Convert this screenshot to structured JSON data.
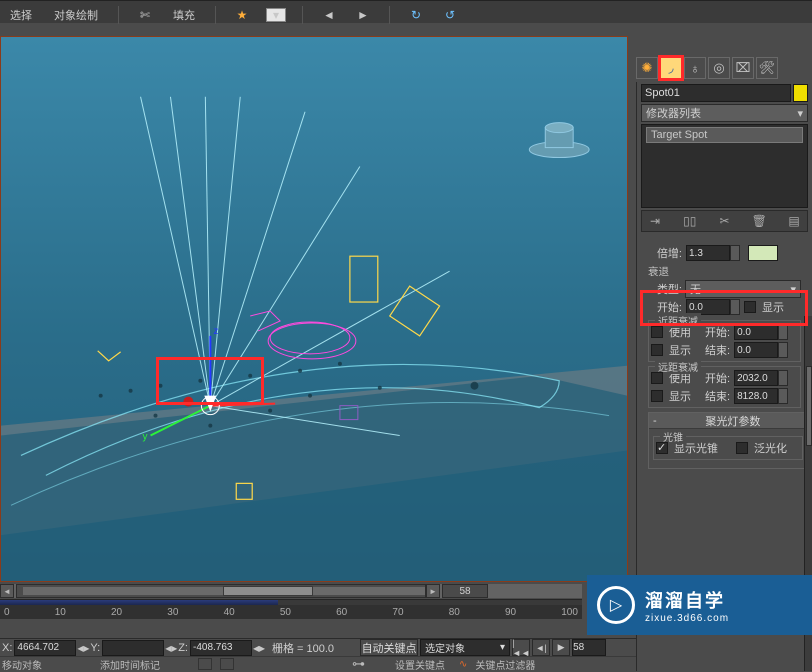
{
  "top_tabs": {
    "select": "选择",
    "object_paint": "对象绘制",
    "fill": "填充"
  },
  "object_name": "Spot01",
  "modifier_list_label": "修改器列表",
  "modstack_item": "Target Spot",
  "intensity": {
    "multiplier_label": "倍增:",
    "multiplier_value": "1.3",
    "decay_label": "衰退",
    "type_label": "类型:",
    "type_value": "无",
    "start_label": "开始:",
    "start_value": "0.0",
    "show_label": "显示"
  },
  "near_atten": {
    "title": "近距衰减",
    "use": "使用",
    "show": "显示",
    "start_label": "开始:",
    "start_value": "0.0",
    "end_label": "结束:",
    "end_value": "0.0"
  },
  "far_atten": {
    "title": "远距衰减",
    "use": "使用",
    "show": "显示",
    "start_label": "开始:",
    "start_value": "2032.0",
    "end_label": "结束:",
    "end_value": "8128.0"
  },
  "spot_params": {
    "title": "聚光灯参数",
    "cone_title": "光锥",
    "show_cone": "显示光锥",
    "overshoot": "泛光化"
  },
  "timeline": {
    "frame_label": "58 / 100",
    "current": "58"
  },
  "ruler": [
    "0",
    "10",
    "20",
    "30",
    "40",
    "50",
    "60",
    "70",
    "80",
    "90",
    "100"
  ],
  "status": {
    "x_label": "X:",
    "x": "4664.702",
    "y_label": "Y:",
    "y": "",
    "z_label": "Z:",
    "z": "-408.763",
    "grid": "栅格 = 100.0",
    "autokey": "自动关键点",
    "keyfilter_sel": "选定对象",
    "frame": "58"
  },
  "status2": {
    "move": "移动对象",
    "addtag": "添加时间标记",
    "setkey": "设置关键点",
    "keyfilter": "关键点过滤器"
  },
  "watermark": {
    "l1": "溜溜自学",
    "l2": "zixue.3d66.com",
    "play": "▷"
  }
}
